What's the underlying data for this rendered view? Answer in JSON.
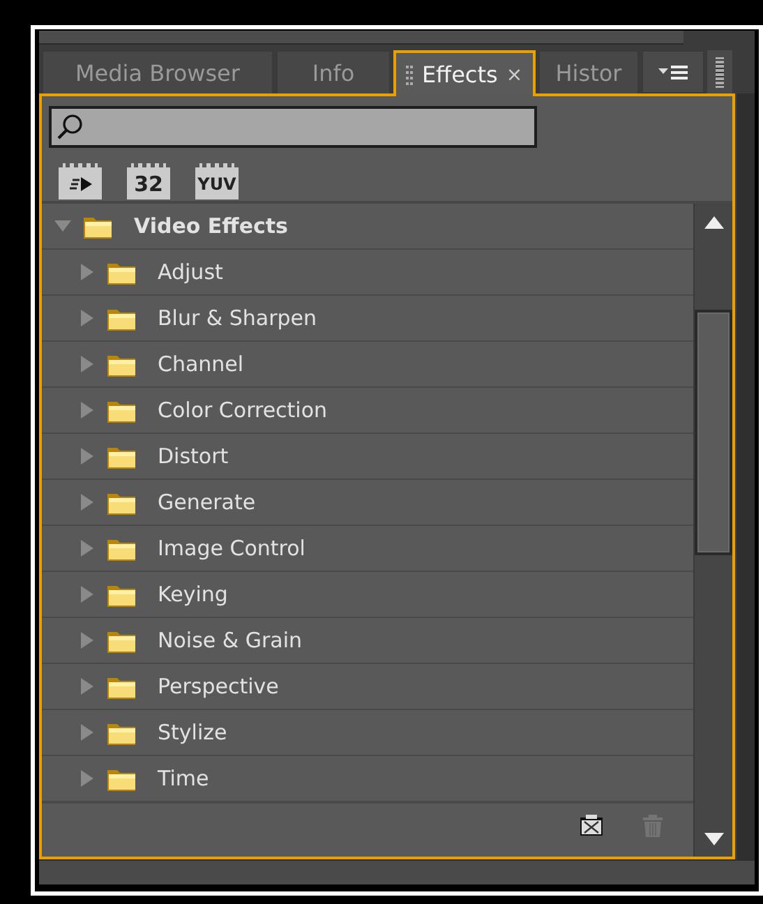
{
  "tabs": [
    {
      "label": "Media Browser",
      "selected": false
    },
    {
      "label": "Info",
      "selected": false
    },
    {
      "label": "Effects",
      "selected": true,
      "close": "×"
    },
    {
      "label": "Histor",
      "selected": false
    }
  ],
  "filter_buttons": [
    {
      "kind": "accelerated"
    },
    {
      "kind": "text",
      "label": "32"
    },
    {
      "kind": "text",
      "label": "YUV"
    }
  ],
  "tree": [
    {
      "label": "Video Effects",
      "expanded": true,
      "children": [
        {
          "label": "Adjust",
          "expanded": false
        },
        {
          "label": "Blur & Sharpen",
          "expanded": false
        },
        {
          "label": "Channel",
          "expanded": false
        },
        {
          "label": "Color Correction",
          "expanded": false
        },
        {
          "label": "Distort",
          "expanded": false
        },
        {
          "label": "Generate",
          "expanded": false
        },
        {
          "label": "Image Control",
          "expanded": false
        },
        {
          "label": "Keying",
          "expanded": false
        },
        {
          "label": "Noise & Grain",
          "expanded": false
        },
        {
          "label": "Perspective",
          "expanded": false
        },
        {
          "label": "Stylize",
          "expanded": false
        },
        {
          "label": "Time",
          "expanded": false
        }
      ]
    }
  ],
  "bottom_buttons": [
    {
      "kind": "new-bin",
      "disabled": false
    },
    {
      "kind": "delete",
      "disabled": true
    }
  ]
}
